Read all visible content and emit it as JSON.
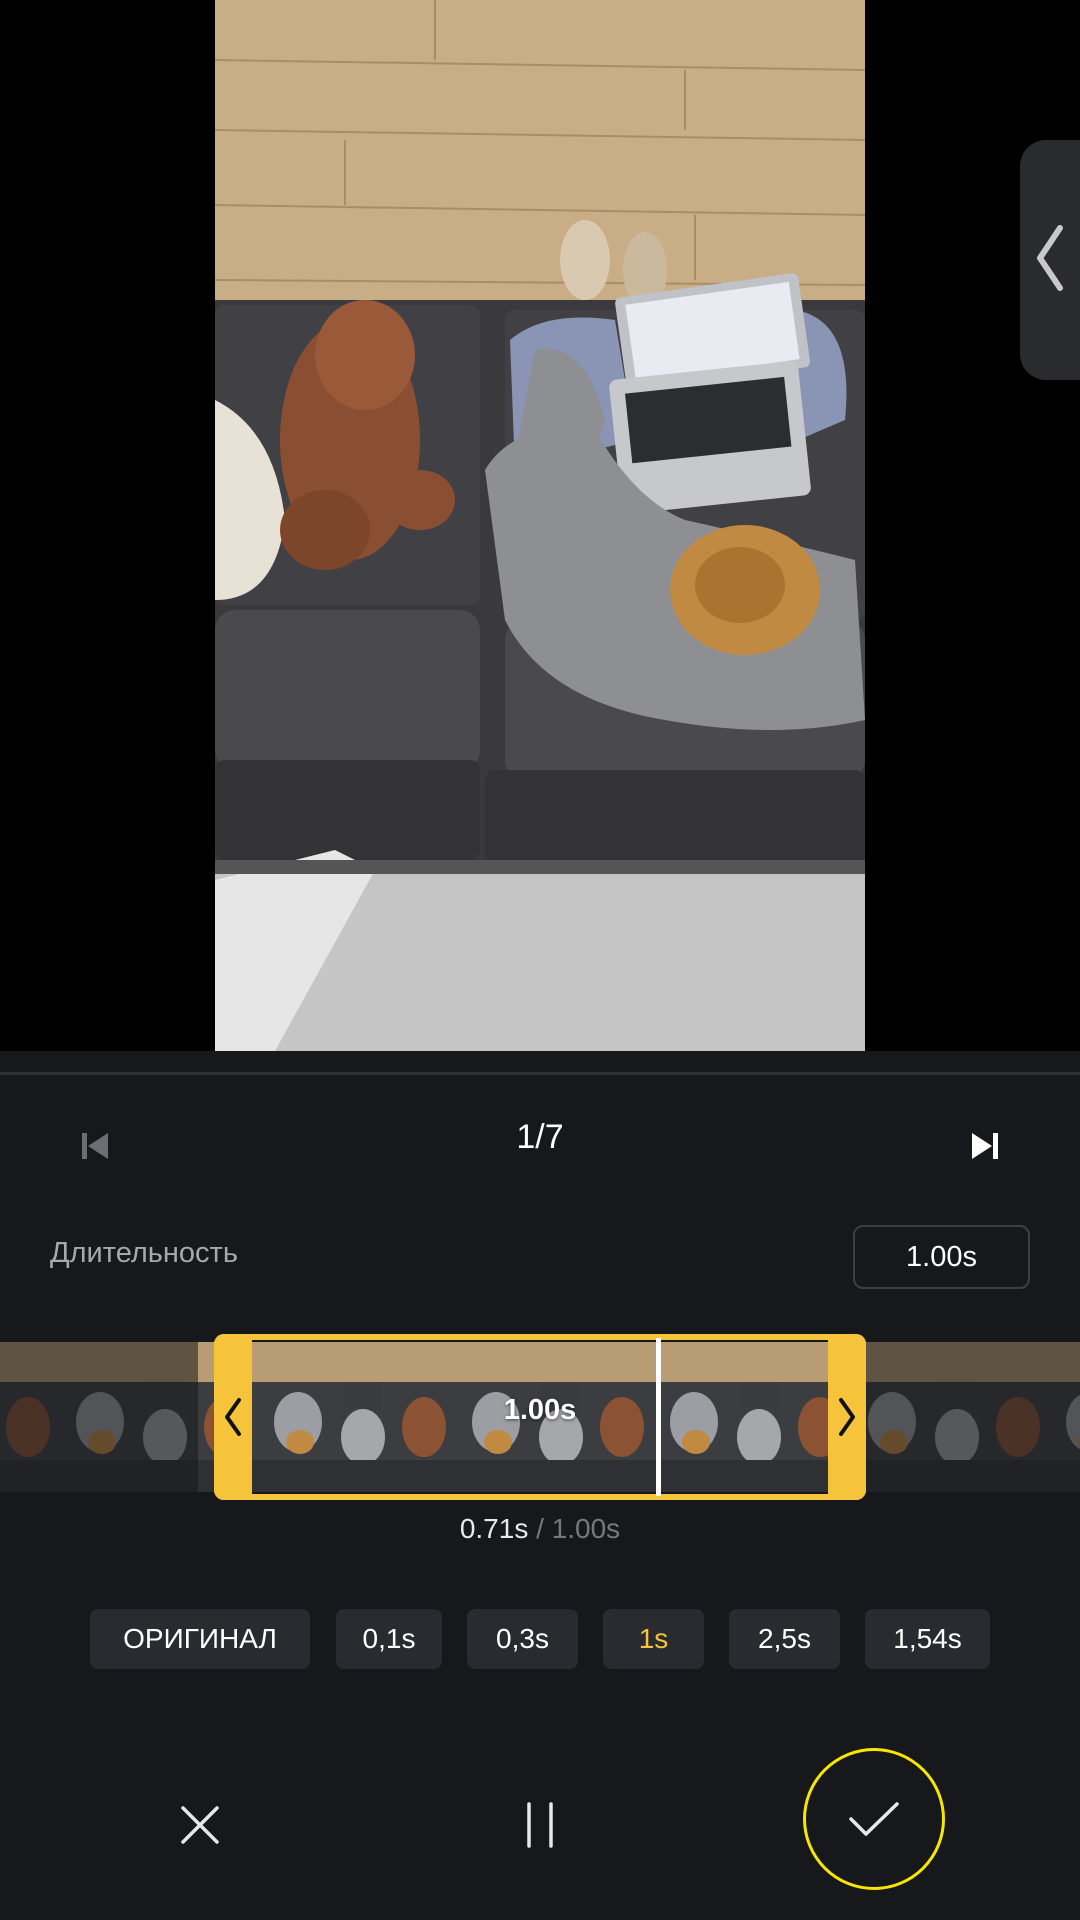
{
  "nav": {
    "counter": "1/7"
  },
  "duration": {
    "label": "Длительность",
    "value": "1.00s"
  },
  "timeline": {
    "clip_label": "1.00s",
    "current": "0.71s",
    "separator": " / ",
    "total": "1.00s",
    "playhead_fraction": 0.71
  },
  "presets": [
    "ОРИГИНАЛ",
    "0,1s",
    "0,3s",
    "1s",
    "2,5s",
    "1,54s"
  ],
  "active_preset": "1s",
  "colors": {
    "accent": "#f5c43b",
    "confirm_ring": "#f7e600",
    "panel": "#17181b",
    "chip": "#2a2b30"
  },
  "icons": [
    "chevron-left-icon",
    "skip-previous-icon",
    "skip-next-icon",
    "close-icon",
    "pause-icon",
    "checkmark-icon"
  ]
}
